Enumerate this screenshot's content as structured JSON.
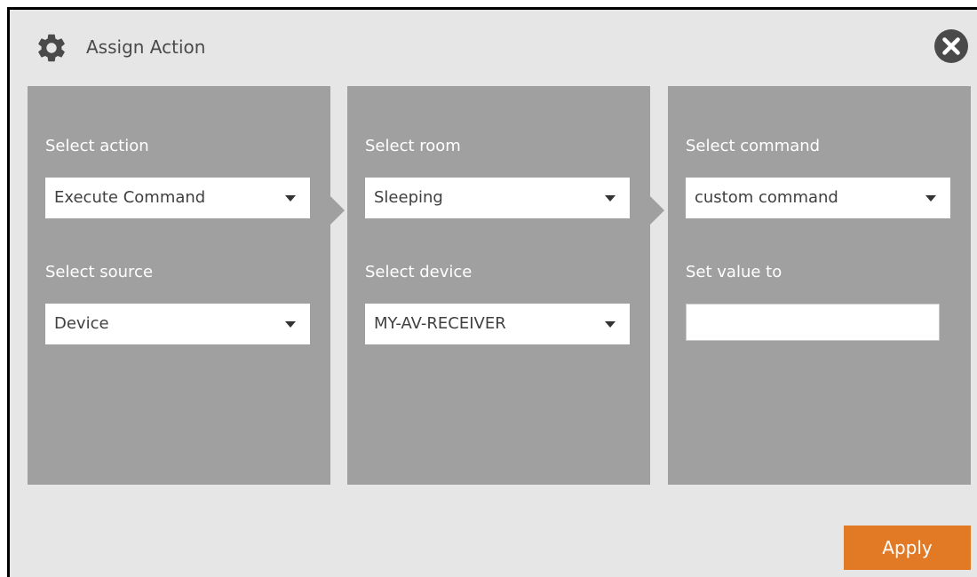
{
  "dialog": {
    "title": "Assign Action",
    "icons": {
      "header": "gear-icon",
      "close": "close-icon"
    }
  },
  "panels": [
    {
      "fields": [
        {
          "label": "Select action",
          "value": "Execute Command"
        },
        {
          "label": "Select source",
          "value": "Device"
        }
      ]
    },
    {
      "fields": [
        {
          "label": "Select room",
          "value": "Sleeping"
        },
        {
          "label": "Select device",
          "value": "MY-AV-RECEIVER"
        }
      ]
    },
    {
      "fields": [
        {
          "label": "Select command",
          "value": "custom command"
        },
        {
          "label": "Set value to",
          "value": ""
        }
      ]
    }
  ],
  "footer": {
    "apply_label": "Apply"
  },
  "colors": {
    "background": "#e6e6e6",
    "panel": "#a0a0a0",
    "accent": "#e27a25",
    "icon": "#4a4a4a"
  }
}
